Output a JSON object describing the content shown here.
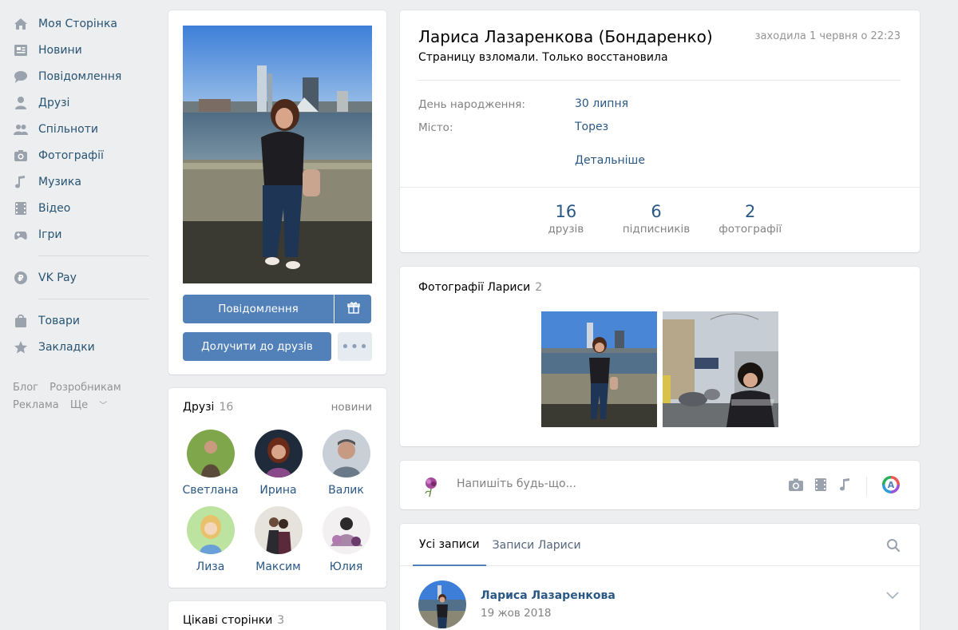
{
  "sidebar": {
    "items": [
      {
        "label": "Моя Сторінка",
        "icon": "home-icon"
      },
      {
        "label": "Новини",
        "icon": "news-icon"
      },
      {
        "label": "Повідомлення",
        "icon": "messages-icon"
      },
      {
        "label": "Друзі",
        "icon": "friends-icon"
      },
      {
        "label": "Спільноти",
        "icon": "communities-icon"
      },
      {
        "label": "Фотографії",
        "icon": "camera-icon"
      },
      {
        "label": "Музика",
        "icon": "music-icon"
      },
      {
        "label": "Відео",
        "icon": "video-icon"
      },
      {
        "label": "Ігри",
        "icon": "gamepad-icon"
      },
      {
        "label": "VK Pay",
        "icon": "vkpay-icon"
      },
      {
        "label": "Товари",
        "icon": "bag-icon"
      },
      {
        "label": "Закладки",
        "icon": "star-icon"
      }
    ],
    "footer": {
      "blog": "Блог",
      "dev": "Розробникам",
      "ads": "Реклама",
      "more": "Ще"
    }
  },
  "avatar_card": {
    "message_button": "Повідомлення",
    "add_friend_button": "Долучити до друзів",
    "gift_icon": "gift-icon",
    "more_icon": "more-icon"
  },
  "friends": {
    "title": "Друзі",
    "count": "16",
    "link": "новини",
    "list": [
      {
        "name": "Светлана"
      },
      {
        "name": "Ирина"
      },
      {
        "name": "Валик"
      },
      {
        "name": "Лиза"
      },
      {
        "name": "Максим"
      },
      {
        "name": "Юлия"
      }
    ]
  },
  "pages": {
    "title": "Цікаві сторінки",
    "count": "3"
  },
  "profile": {
    "name": "Лариса Лазаренкова (Бондаренко)",
    "last_seen": "заходила 1 червня о 22:23",
    "status": "Страницу взломали. Только восстановила",
    "birthday_label": "День народження:",
    "birthday_value": "30 липня",
    "city_label": "Місто:",
    "city_value": "Торез",
    "details_link": "Детальніше",
    "counters": [
      {
        "num": "16",
        "label": "друзів"
      },
      {
        "num": "6",
        "label": "підписників"
      },
      {
        "num": "2",
        "label": "фотографії"
      }
    ]
  },
  "photos": {
    "title": "Фотографії Лариси",
    "count": "2"
  },
  "compose": {
    "placeholder": "Напишіть будь-що..."
  },
  "wall": {
    "tabs": [
      "Усі записи",
      "Записи Лариси"
    ],
    "post": {
      "author": "Лариса Лазаренкова",
      "date": "19 жов 2018"
    }
  },
  "colors": {
    "accent": "#5181b8",
    "link": "#2a5885",
    "background": "#edeef0"
  }
}
